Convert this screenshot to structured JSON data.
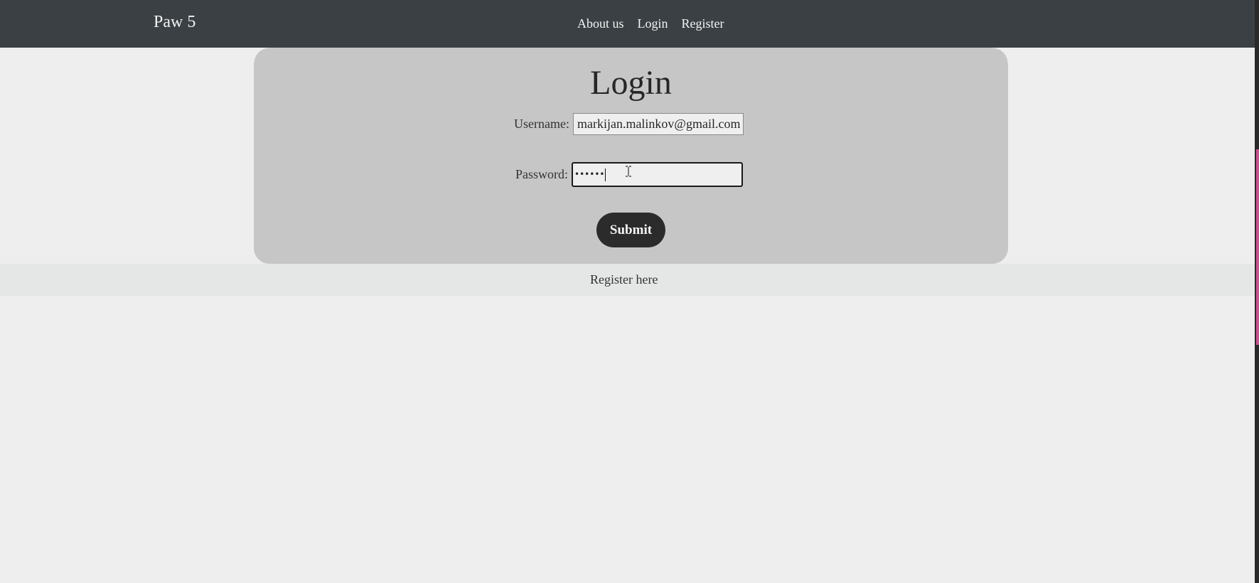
{
  "navbar": {
    "brand": "Paw 5",
    "links": [
      "About us",
      "Login",
      "Register"
    ]
  },
  "login": {
    "title": "Login",
    "username_label": "Username:",
    "username_value": "markijan.malinkov@gmail.com",
    "password_label": "Password:",
    "password_mask": "••••••",
    "submit_label": "Submit"
  },
  "footer": {
    "register_link": "Register here"
  },
  "colors": {
    "navbar_bg": "#3a4044",
    "panel_bg": "#c6c6c6",
    "page_bg": "#eeeeee",
    "button_bg": "#2b2b2b"
  },
  "icons": [
    "text-cursor-icon"
  ]
}
